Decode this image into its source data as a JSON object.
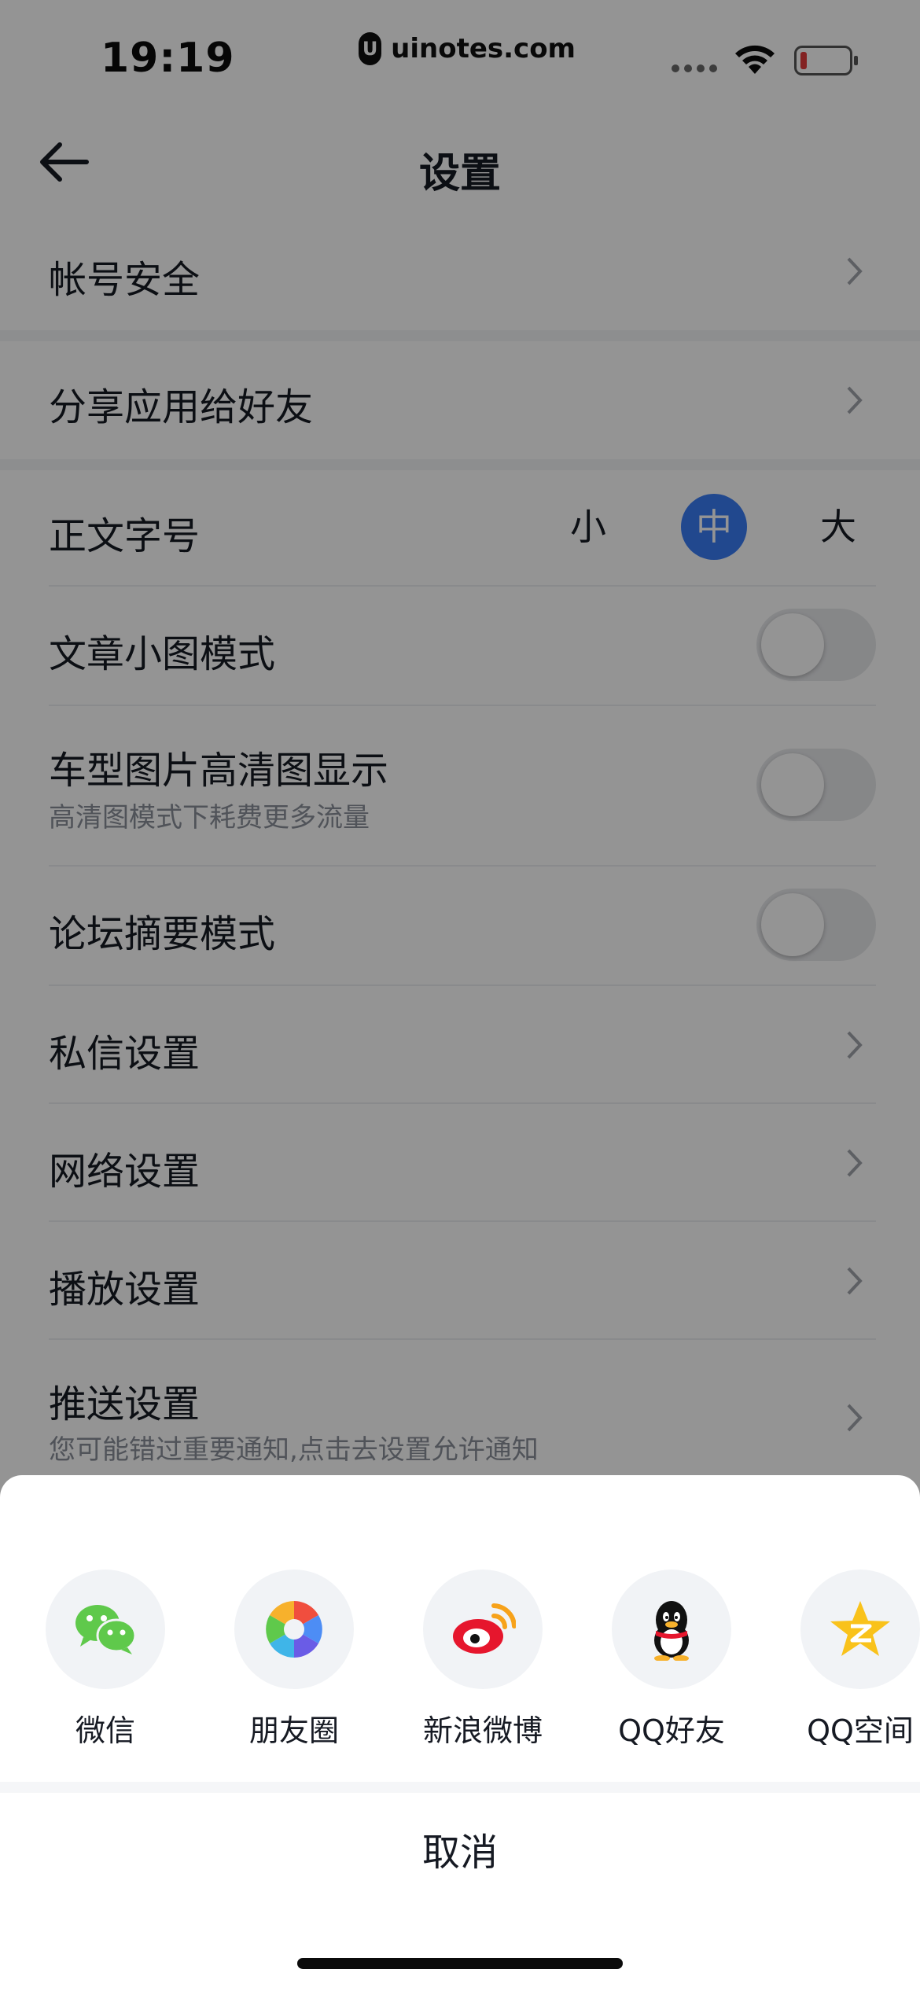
{
  "status_bar": {
    "time": "19:19",
    "site": "uinotes.com",
    "site_logo": "U",
    "battery_color": "#e23b3b"
  },
  "nav": {
    "title": "设置",
    "back_icon": "arrow-left-icon"
  },
  "settings": {
    "account_security": "帐号安全",
    "share_app": "分享应用给好友",
    "font_size": {
      "label": "正文字号",
      "options": [
        "小",
        "中",
        "大"
      ],
      "selected": "中",
      "accent": "#3a7cf5"
    },
    "article_small_image": {
      "label": "文章小图模式",
      "on": false
    },
    "hd_images": {
      "label": "车型图片高清图显示",
      "sub": "高清图模式下耗费更多流量",
      "on": false
    },
    "forum_summary": {
      "label": "论坛摘要模式",
      "on": false
    },
    "private_message": "私信设置",
    "network": "网络设置",
    "playback": "播放设置",
    "push": {
      "label": "推送设置",
      "sub": "您可能错过重要通知,点击去设置允许通知"
    }
  },
  "share_sheet": {
    "items": [
      {
        "label": "微信",
        "icon": "wechat-icon"
      },
      {
        "label": "朋友圈",
        "icon": "moments-icon"
      },
      {
        "label": "新浪微博",
        "icon": "weibo-icon"
      },
      {
        "label": "QQ好友",
        "icon": "qq-icon"
      },
      {
        "label": "QQ空间",
        "icon": "qzone-icon"
      }
    ],
    "cancel": "取消"
  }
}
